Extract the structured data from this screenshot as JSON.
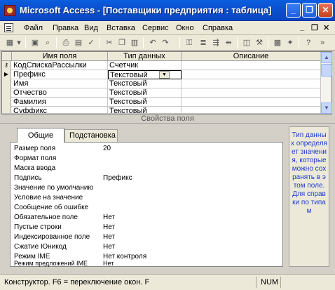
{
  "window": {
    "title": "Microsoft Access - [Поставщики предприятия : таблица]",
    "minimize": "_",
    "restore": "❐",
    "close": "✕"
  },
  "menu": {
    "items": [
      "Файл",
      "Правка",
      "Вид",
      "Вставка",
      "Сервис",
      "Окно",
      "Справка"
    ],
    "mdi_minimize": "_",
    "mdi_restore": "❐",
    "mdi_close": "✕"
  },
  "grid": {
    "columns": [
      "Имя поля",
      "Тип данных",
      "Описание"
    ],
    "rows": [
      {
        "marker": "key",
        "name": "КодСпискаРассылки",
        "type": "Счетчик"
      },
      {
        "marker": "current",
        "name": "Префикс",
        "type": "Текстовый"
      },
      {
        "marker": "",
        "name": "Имя",
        "type": "Текстовый"
      },
      {
        "marker": "",
        "name": "Отчество",
        "type": "Текстовый"
      },
      {
        "marker": "",
        "name": "Фамилия",
        "type": "Текстовый"
      },
      {
        "marker": "",
        "name": "Суффикс",
        "type": "Текстовый"
      }
    ]
  },
  "properties": {
    "label": "Свойства поля",
    "tabs": [
      "Общие",
      "Подстановка"
    ],
    "rows": [
      {
        "name": "Размер поля",
        "value": "20"
      },
      {
        "name": "Формат поля",
        "value": ""
      },
      {
        "name": "Маска ввода",
        "value": ""
      },
      {
        "name": "Подпись",
        "value": "Префикс"
      },
      {
        "name": "Значение по умолчанию",
        "value": ""
      },
      {
        "name": "Условие на значение",
        "value": ""
      },
      {
        "name": "Сообщение об ошибке",
        "value": ""
      },
      {
        "name": "Обязательное поле",
        "value": "Нет"
      },
      {
        "name": "Пустые строки",
        "value": "Нет"
      },
      {
        "name": "Индексированное поле",
        "value": "Нет"
      },
      {
        "name": "Сжатие Юникод",
        "value": "Нет"
      },
      {
        "name": "Режим IME",
        "value": "Нет контроля"
      },
      {
        "name": "Режим предложений IME",
        "value": "Нет"
      }
    ],
    "help": "Тип данных определяет значения, которые можно сохранять в этом поле. Для справки по типам"
  },
  "status": {
    "text": "Конструктор. F6 = переключение окон. F",
    "num": "NUM"
  },
  "colors": {
    "titlebar": "#0a4fcd",
    "help_text": "#1c3bd0"
  }
}
